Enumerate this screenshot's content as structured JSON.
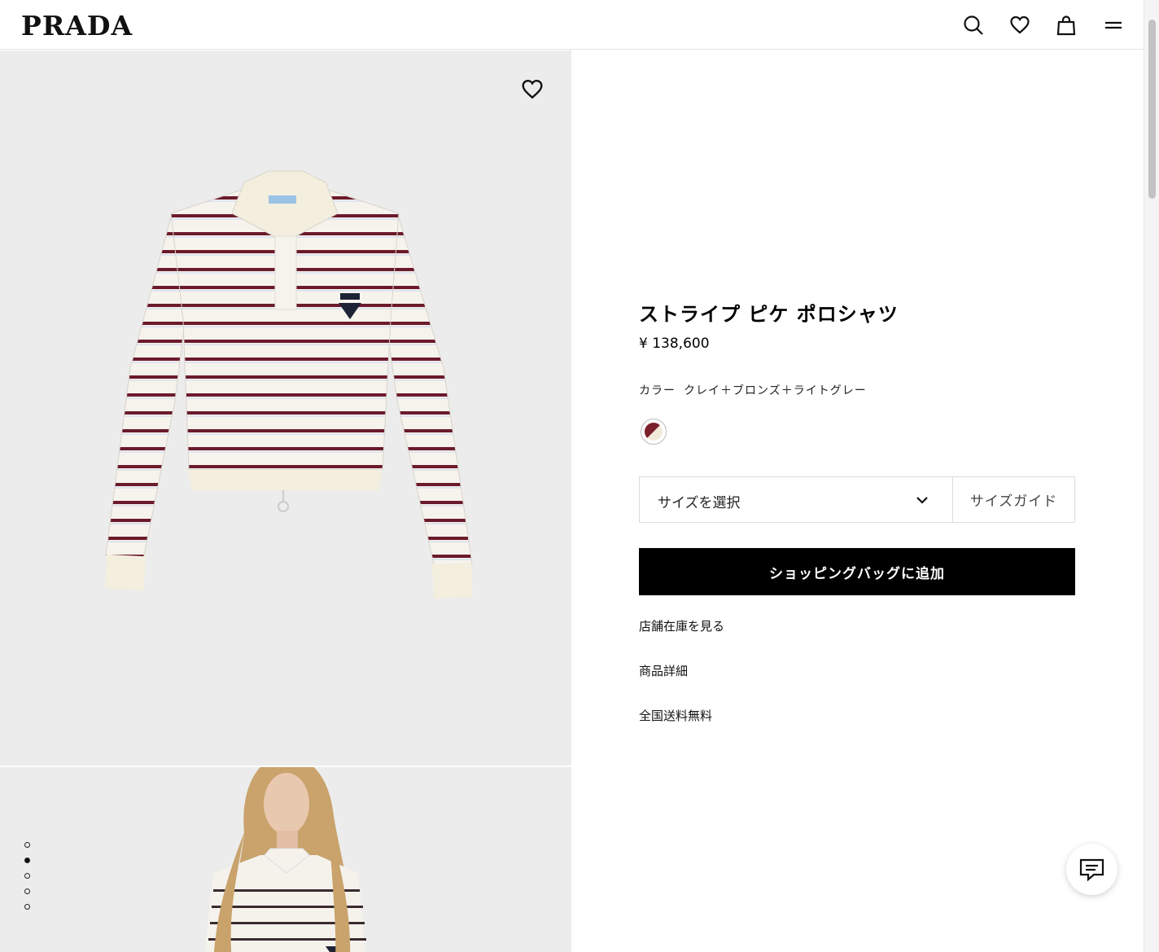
{
  "header": {
    "logo": "PRADA",
    "icons": [
      "search-icon",
      "heart-icon",
      "bag-icon",
      "menu-icon"
    ]
  },
  "gallery": {
    "wishlist_icon": "heart-icon",
    "dots": [
      false,
      true,
      false,
      false,
      false
    ]
  },
  "product": {
    "title": "ストライプ ピケ ポロシャツ",
    "price": "¥ 138,600",
    "color_label": "カラー",
    "color_value": "クレイ＋ブロンズ＋ライトグレー",
    "swatch_colors": [
      "#7a1f2b",
      "#f1ead9"
    ],
    "size_select_label": "サイズを選択",
    "size_guide_label": "サイズガイド",
    "add_to_bag_label": "ショッピングバッグに追加",
    "links": [
      "店舗在庫を見る",
      "商品詳細",
      "全国送料無料"
    ]
  },
  "chat": {
    "icon": "chat-icon"
  }
}
